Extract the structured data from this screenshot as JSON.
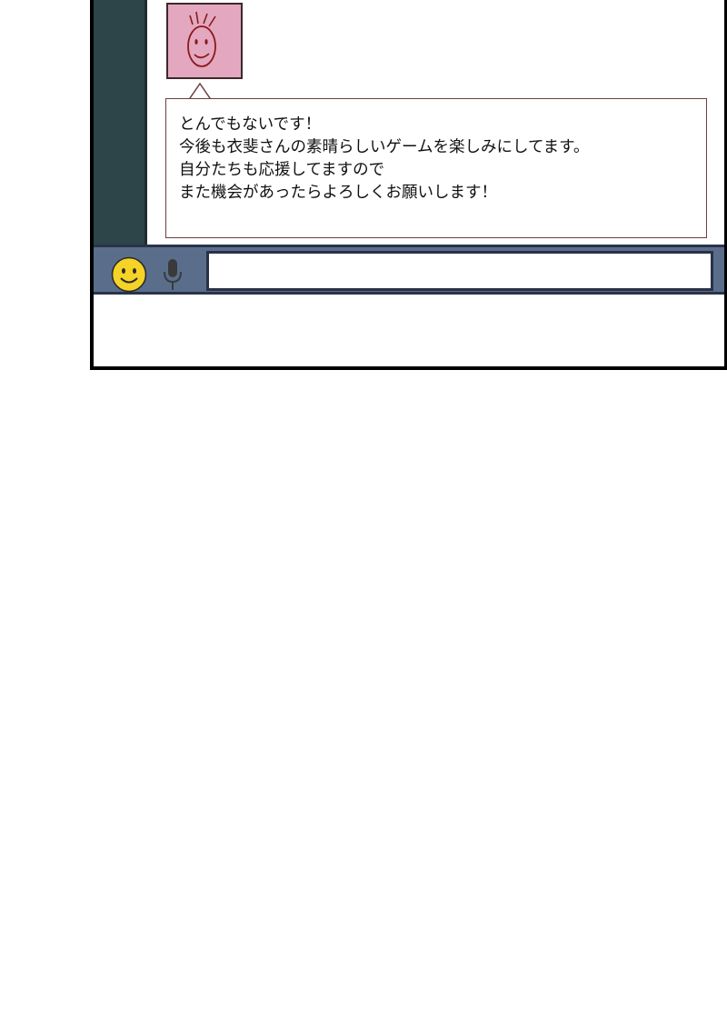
{
  "chat": {
    "message": {
      "lines": [
        "とんでもないです！",
        "今後も衣斐さんの素晴らしいゲームを楽しみにしてます。",
        "自分たちも応援してますので",
        "また機会があったらよろしくお願いします！"
      ]
    }
  },
  "input_bar": {
    "emoji_icon": "smiley-icon",
    "mic_icon": "microphone-icon",
    "text_value": ""
  },
  "colors": {
    "sidebar": "#2d4448",
    "avatar_bg": "#e4a7c0",
    "input_bar": "#5a6e8c",
    "smiley": "#f5d327"
  }
}
